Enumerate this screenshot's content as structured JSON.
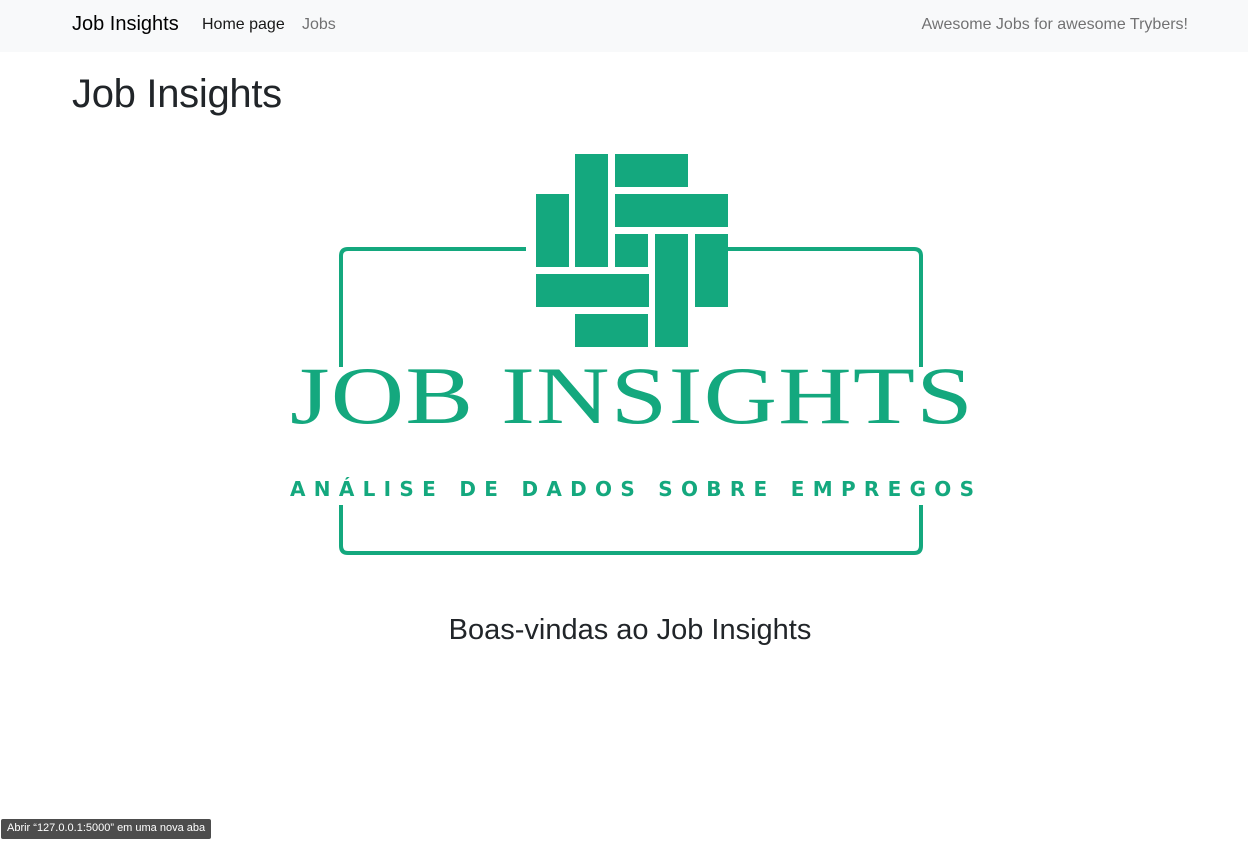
{
  "navbar": {
    "brand": "Job Insights",
    "links": [
      {
        "label": "Home page"
      },
      {
        "label": "Jobs"
      }
    ],
    "tagline": "Awesome Jobs for awesome Trybers!"
  },
  "main": {
    "title": "Job Insights",
    "logo": {
      "wordmark": "JOB INSIGHTS",
      "subtitle": "ANÁLISE DE DADOS SOBRE EMPREGOS",
      "color": "#14a87e"
    },
    "welcome": "Boas-vindas ao Job Insights"
  },
  "status_bar": {
    "tooltip": "Abrir “127.0.0.1:5000” em uma nova aba"
  }
}
